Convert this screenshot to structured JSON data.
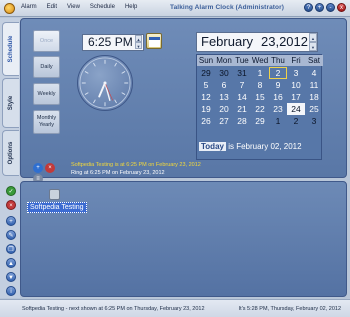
{
  "window": {
    "title": "Talking Alarm Clock (Administrator)",
    "menu": [
      "Alarm",
      "Edit",
      "View",
      "Schedule",
      "Help"
    ],
    "controls": [
      "?",
      "+",
      "-",
      "x"
    ]
  },
  "side_tabs": [
    "Schedule",
    "Style",
    "Options"
  ],
  "schedule_types": [
    "Once",
    "Daily",
    "Weekly",
    "Monthly Yearly"
  ],
  "time": {
    "value": "6:25 PM",
    "spin_up": "▲",
    "spin_down": "▼"
  },
  "date": {
    "month": "February",
    "day_year": "23,2012",
    "spin_up": "▲",
    "spin_down": "▼"
  },
  "calendar": {
    "weekdays": [
      "Sun",
      "Mon",
      "Tue",
      "Wed",
      "Thu",
      "Fri",
      "Sat"
    ],
    "cells": [
      "29",
      "30",
      "31",
      "1",
      "2",
      "3",
      "4",
      "5",
      "6",
      "7",
      "8",
      "9",
      "10",
      "11",
      "12",
      "13",
      "14",
      "15",
      "16",
      "17",
      "18",
      "19",
      "20",
      "21",
      "22",
      "23",
      "24",
      "25",
      "26",
      "27",
      "28",
      "29",
      "1",
      "2",
      "3"
    ],
    "today_label": "Today",
    "today_text": "is February 02, 2012"
  },
  "details": {
    "line1": "Softpedia Testing is at 6:25 PM on February 23, 2012",
    "line2": "Ring at 6:25 PM on February 23, 2012"
  },
  "alarms": [
    {
      "label": "Softpedia Testing"
    }
  ],
  "status": {
    "left": "Softpedia Testing - next shown at 6:25 PM on Thursday, February 23, 2012",
    "right": "It's 5:28 PM, Thursday, February 02, 2012"
  },
  "colors": {
    "accent": "#3c6bd1",
    "panel": "#5977a6",
    "info_text": "#f4d93a"
  }
}
